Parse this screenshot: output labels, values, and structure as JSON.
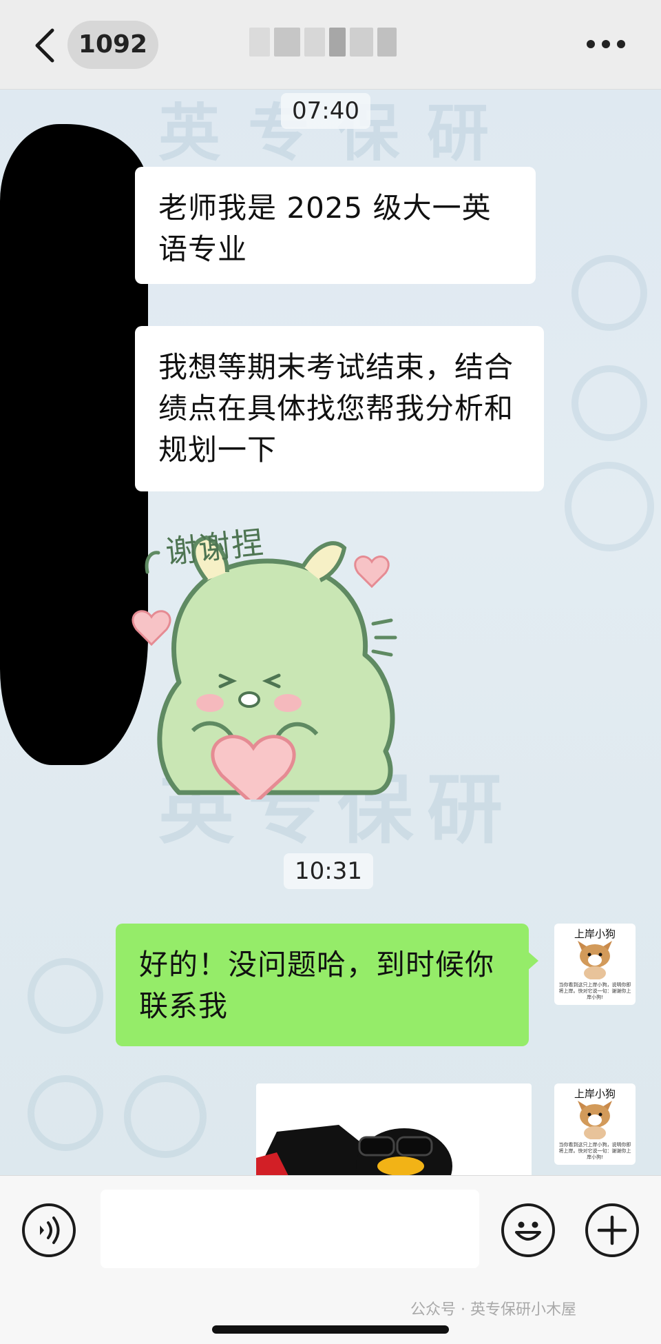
{
  "header": {
    "unread_count": "1092"
  },
  "messages": {
    "time_1": "07:40",
    "msg_1": "老师我是 2025 级大一英语专业",
    "msg_2": "我想等期末考试结束，结合绩点在具体找您帮我分析和规划一下",
    "sticker_caption": "谢谢捏",
    "time_2": "10:31",
    "reply_1": "好的！没问题哈，到时候你联系我",
    "avatar_caption": "上岸小狗",
    "avatar_fine_print": "当你看到这只上岸小狗，说明你即将上岸。快对它说一句：谢谢你上岸小狗!"
  },
  "background_watermark": {
    "text_top": "英专保研",
    "text_mid": "英专保研"
  },
  "footer": {
    "watermark": "公众号 · 英专保研小木屋"
  },
  "colors": {
    "self_bubble": "#95ec69",
    "other_bubble": "#ffffff",
    "sticker_green": "#c9e6b4",
    "sticker_outline": "#5f8a62",
    "heart": "#f5a8ae"
  },
  "icons": [
    "back-icon",
    "more-icon",
    "voice-icon",
    "emoji-icon",
    "add-icon"
  ]
}
